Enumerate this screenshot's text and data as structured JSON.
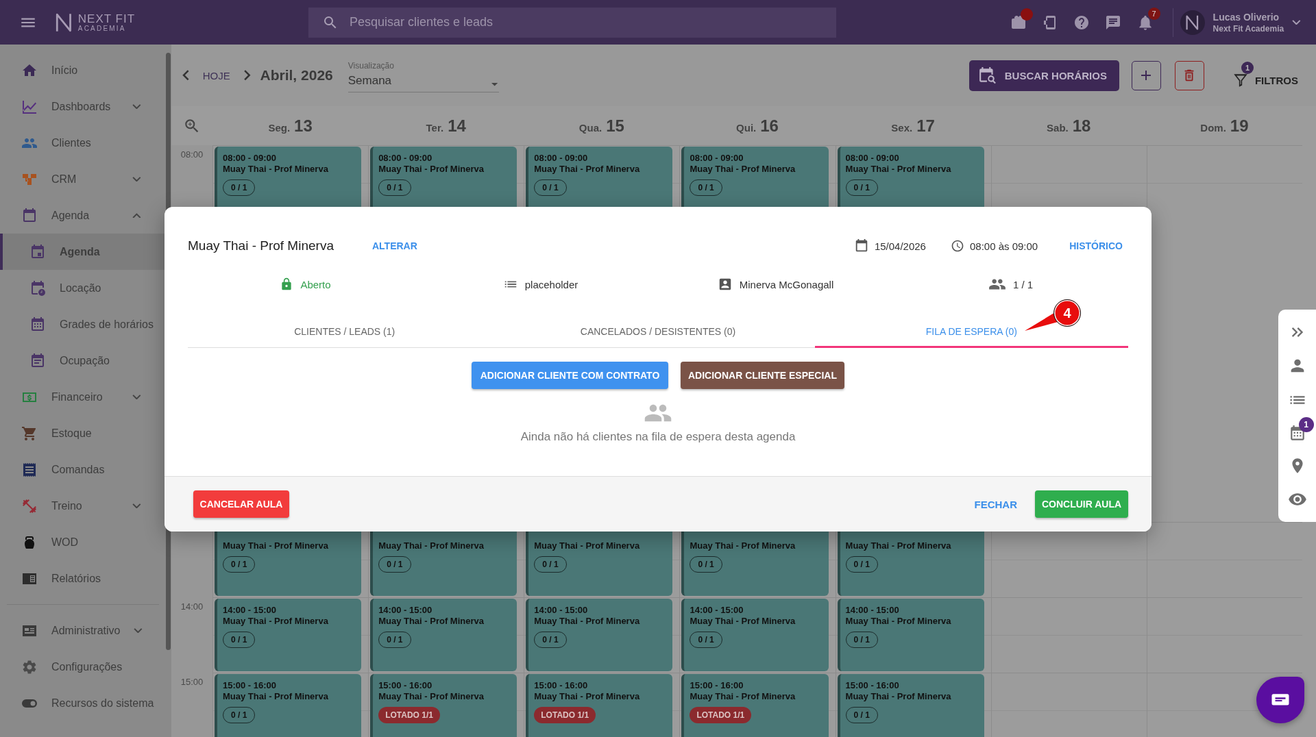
{
  "topbar": {
    "brand": "NEXT FIT",
    "brand_sub": "ACADEMIA",
    "search": {
      "placeholder": "Pesquisar clientes e leads"
    },
    "gift_dot": true,
    "notification_count": "7",
    "user": {
      "name": "Lucas Oliverio",
      "org": "Next Fit Academia"
    }
  },
  "sidebar": {
    "groups": [
      {
        "items": [
          {
            "label": "Início",
            "selected": false
          },
          {
            "label": "Dashboards",
            "expanded": false,
            "selected": false
          },
          {
            "label": "Clientes",
            "selected": false
          },
          {
            "label": "CRM",
            "expanded": false,
            "selected": false
          },
          {
            "label": "Agenda",
            "expanded": true,
            "selected": false,
            "children": [
              {
                "label": "Agenda",
                "selected": true
              },
              {
                "label": "Locação",
                "selected": false
              },
              {
                "label": "Grades de horários",
                "selected": false
              },
              {
                "label": "Ocupação",
                "selected": false
              }
            ]
          },
          {
            "label": "Financeiro",
            "expanded": false,
            "selected": false
          },
          {
            "label": "Estoque",
            "selected": false
          },
          {
            "label": "Comandas",
            "selected": false
          },
          {
            "label": "Treino",
            "expanded": false,
            "selected": false
          },
          {
            "label": "WOD",
            "selected": false
          },
          {
            "label": "Relatórios",
            "selected": false
          }
        ]
      },
      {
        "items": [
          {
            "label": "Administrativo",
            "expanded": false,
            "selected": false
          },
          {
            "label": "Configurações",
            "selected": false
          },
          {
            "label": "Recursos do sistema",
            "selected": false
          }
        ]
      }
    ]
  },
  "toolbar": {
    "today": "HOJE",
    "period": "Abril, 2026",
    "view": {
      "label": "Visualização",
      "value": "Semana"
    },
    "search_button": "BUSCAR HORÁRIOS",
    "filters": {
      "label": "FILTROS",
      "count": "1"
    }
  },
  "calendar": {
    "days": [
      {
        "weekday": "Seg.",
        "number": "13"
      },
      {
        "weekday": "Ter.",
        "number": "14"
      },
      {
        "weekday": "Qua.",
        "number": "15"
      },
      {
        "weekday": "Qui.",
        "number": "16"
      },
      {
        "weekday": "Sex.",
        "number": "17"
      },
      {
        "weekday": "Sab.",
        "number": "18"
      },
      {
        "weekday": "Dom.",
        "number": "19"
      }
    ],
    "rows": [
      {
        "time": "08:00",
        "events": [
          {
            "time": "08:00 - 09:00",
            "title": "Muay Thai - Prof Minerva",
            "kind": "count",
            "badge": "0 / 1"
          },
          {
            "time": "08:00 - 09:00",
            "title": "Muay Thai - Prof Minerva",
            "kind": "count",
            "badge": "0 / 1"
          },
          {
            "time": "08:00 - 09:00",
            "title": "Muay Thai - Prof Minerva",
            "kind": "count",
            "badge": "0 / 1"
          },
          {
            "time": "08:00 - 09:00",
            "title": "Muay Thai - Prof Minerva",
            "kind": "count",
            "badge": "0 / 1"
          },
          {
            "time": "08:00 - 09:00",
            "title": "Muay Thai - Prof Minerva",
            "kind": "count",
            "badge": "0 / 1"
          }
        ]
      },
      {
        "events": [
          {
            "title": "Muay Thai - Prof Minerva",
            "kind": "count",
            "badge": "0 / 1"
          },
          {
            "title": "Muay Thai - Prof Minerva",
            "kind": "count",
            "badge": "0 / 1"
          },
          {
            "title": "Muay Thai - Prof Minerva",
            "kind": "count",
            "badge": "0 / 1"
          },
          {
            "title": "Muay Thai - Prof Minerva",
            "kind": "count",
            "badge": "0 / 1"
          },
          {
            "title": "Muay Thai - Prof Minerva",
            "kind": "count",
            "badge": "0 / 1"
          }
        ]
      },
      {
        "time": "14:00",
        "events": [
          {
            "time": "14:00 - 15:00",
            "title": "Muay Thai - Prof Minerva",
            "kind": "count",
            "badge": "0 / 1"
          },
          {
            "time": "14:00 - 15:00",
            "title": "Muay Thai - Prof Minerva",
            "kind": "count",
            "badge": "0 / 1"
          },
          {
            "time": "14:00 - 15:00",
            "title": "Muay Thai - Prof Minerva",
            "kind": "count",
            "badge": "0 / 1"
          },
          {
            "time": "14:00 - 15:00",
            "title": "Muay Thai - Prof Minerva",
            "kind": "count",
            "badge": "0 / 1"
          },
          {
            "time": "14:00 - 15:00",
            "title": "Muay Thai - Prof Minerva",
            "kind": "count",
            "badge": "0 / 1"
          }
        ]
      },
      {
        "time": "15:00",
        "events": [
          {
            "time": "15:00 - 16:00",
            "title": "Muay Thai - Prof Minerva",
            "kind": "count",
            "badge": "0 / 1"
          },
          {
            "time": "15:00 - 16:00",
            "title": "Muay Thai - Prof Minerva",
            "kind": "full",
            "badge": "LOTADO 1/1"
          },
          {
            "time": "15:00 - 16:00",
            "title": "Muay Thai - Prof Minerva",
            "kind": "full",
            "badge": "LOTADO 1/1"
          },
          {
            "time": "15:00 - 16:00",
            "title": "Muay Thai - Prof Minerva",
            "kind": "full",
            "badge": "LOTADO 1/1"
          },
          {
            "time": "15:00 - 16:00",
            "title": "Muay Thai - Prof Minerva",
            "kind": "count",
            "badge": "0 / 1"
          }
        ]
      }
    ]
  },
  "dialog": {
    "title": "Muay Thai - Prof Minerva",
    "change": "ALTERAR",
    "date": "15/04/2026",
    "time": "08:00 às 09:00",
    "history": "HISTÓRICO",
    "status": "Aberto",
    "category": "placeholder",
    "instructor": "Minerva McGonagall",
    "occupancy": "1 / 1",
    "tabs": [
      {
        "label": "CLIENTES / LEADS (1)",
        "selected": false
      },
      {
        "label": "CANCELADOS / DESISTENTES (0)",
        "selected": false
      },
      {
        "label": "FILA DE ESPERA (0)",
        "selected": true
      }
    ],
    "add_contract": "ADICIONAR CLIENTE COM CONTRATO",
    "add_special": "ADICIONAR CLIENTE ESPECIAL",
    "empty": "Ainda não há clientes na fila de espera desta agenda",
    "cancel": "CANCELAR AULA",
    "close": "FECHAR",
    "finish": "CONCLUIR AULA"
  },
  "annotation": {
    "label": "4"
  },
  "side_panel": {
    "schedule_count": "1"
  }
}
